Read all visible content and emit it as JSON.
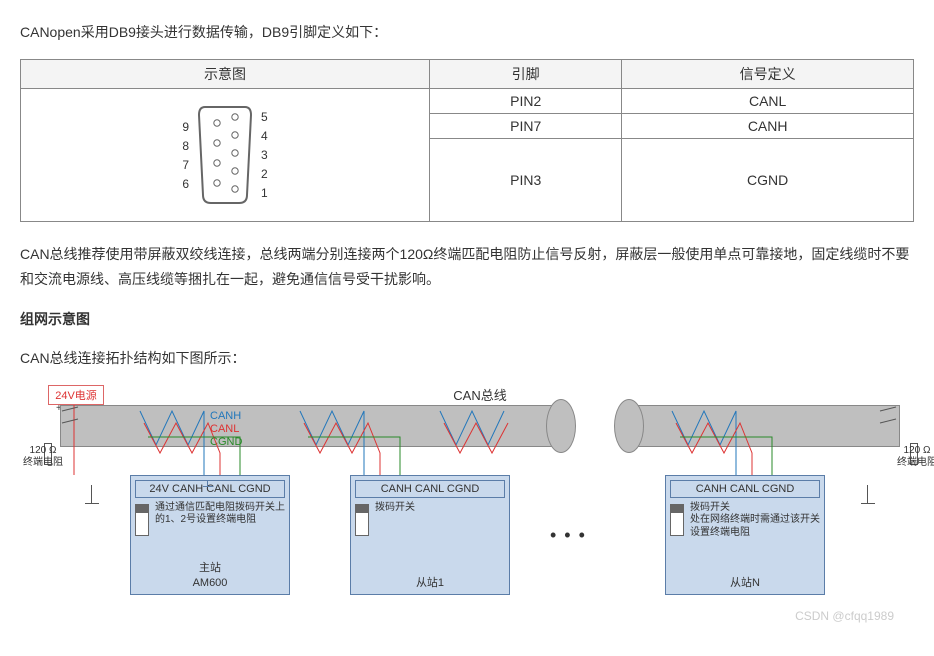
{
  "intro": "CANopen采用DB9接头进行数据传输，DB9引脚定义如下：",
  "table": {
    "h1": "示意图",
    "h2": "引脚",
    "h3": "信号定义",
    "rows": [
      {
        "pin": "PIN2",
        "sig": "CANL"
      },
      {
        "pin": "PIN7",
        "sig": "CANH"
      },
      {
        "pin": "PIN3",
        "sig": "CGND"
      }
    ],
    "db9_left": [
      "9",
      "8",
      "7",
      "6"
    ],
    "db9_right": [
      "5",
      "4",
      "3",
      "2",
      "1"
    ]
  },
  "para2": "CAN总线推荐使用带屏蔽双绞线连接，总线两端分别连接两个120Ω终端匹配电阻防止信号反射，屏蔽层一般使用单点可靠接地，固定线缆时不要和交流电源线、高压线缆等捆扎在一起，避免通信信号受干扰影响。",
  "heading": "组网示意图",
  "para3": "CAN总线连接拓扑结构如下图所示：",
  "topo": {
    "ps": "24V电源",
    "bus_title": "CAN总线",
    "canh": "CANH",
    "canl": "CANL",
    "cgnd": "CGND",
    "res120": "120 Ω",
    "res_lbl": "终端电阻",
    "node1": {
      "pins": "24V CANH   CANL CGND",
      "desc": "通过通信匹配电阻拨码开关上的1、2号设置终端电阻",
      "name": "主站",
      "model": "AM600"
    },
    "node2": {
      "pins": "CANH   CANL  CGND",
      "desc": "拨码开关",
      "name": "从站1"
    },
    "node3": {
      "pins": "CANH   CANL  CGND",
      "desc": "拨码开关\n处在网络终端时需通过该开关设置终端电阻",
      "name": "从站N"
    }
  },
  "watermark": "CSDN @cfqq1989"
}
